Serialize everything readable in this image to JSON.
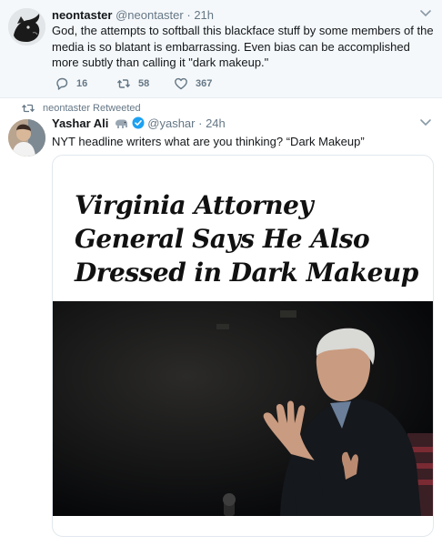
{
  "tweet1": {
    "display_name": "neontaster",
    "handle": "@neontaster",
    "time": "21h",
    "text": "God, the attempts to softball this blackface stuff by some members of the media is so blatant is embarrassing. Even bias can be accomplished more subtly than calling it \"dark makeup.\"",
    "replies": "16",
    "retweets": "58",
    "likes": "367"
  },
  "retweet_context": "neontaster Retweeted",
  "tweet2": {
    "display_name": "Yashar Ali",
    "handle": "@yashar",
    "time": "24h",
    "text": "NYT headline writers what are you thinking? “Dark Makeup”",
    "card_headline": "Virginia Attorney General Says He Also Dressed in Dark Makeup"
  },
  "icons": {
    "reply": "reply-icon",
    "retweet": "retweet-icon",
    "like": "heart-icon",
    "caret": "chevron-down-icon",
    "verified": "verified-badge-icon",
    "emoji": "elephant-emoji-icon"
  },
  "colors": {
    "muted": "#657786",
    "verified": "#1da1f2",
    "tweet_bg": "#f5f8fa"
  }
}
